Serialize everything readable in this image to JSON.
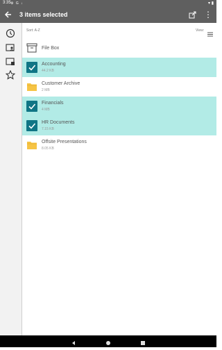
{
  "status_bar": {
    "time": "3:35",
    "left_icons": [
      "gear-icon",
      "g-icon",
      "download-icon"
    ],
    "right_icons": [
      "wifi-icon",
      "battery-icon"
    ]
  },
  "app_bar": {
    "title": "3 items selected",
    "background": "#5f5f5f"
  },
  "toolbar": {
    "sort_label": "Sort: A-Z",
    "view_label": "View:"
  },
  "sidebar": {
    "items": [
      {
        "icon": "clock-icon"
      },
      {
        "icon": "person-folder-icon"
      },
      {
        "icon": "shared-folder-icon"
      },
      {
        "icon": "star-icon"
      }
    ]
  },
  "items": [
    {
      "name": "File Box",
      "meta": "",
      "type": "box",
      "selected": false
    },
    {
      "name": "Accounting",
      "meta": "44.2 KB",
      "type": "folder",
      "selected": true
    },
    {
      "name": "Customer Archive",
      "meta": "2 MB",
      "type": "folder",
      "selected": false
    },
    {
      "name": "Financials",
      "meta": "4 MB",
      "type": "folder",
      "selected": true
    },
    {
      "name": "HR Documents",
      "meta": "7.15 KB",
      "type": "folder",
      "selected": true
    },
    {
      "name": "Offsite Presentations",
      "meta": "8.05 KB",
      "type": "folder",
      "selected": false
    }
  ],
  "colors": {
    "accent": "#107585",
    "selected_row": "#b2ebe6",
    "folder": "#f6c445"
  }
}
